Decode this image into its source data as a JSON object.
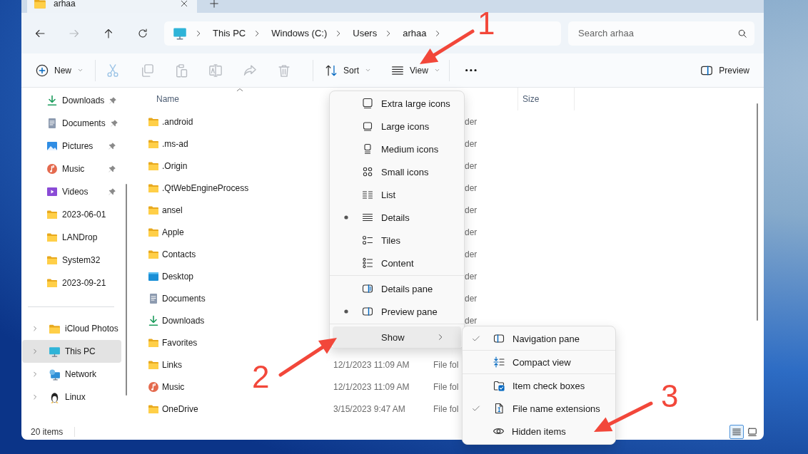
{
  "window": {
    "tab": {
      "title": "arhaa"
    }
  },
  "address_bar": {
    "nav": [
      {
        "kind": "back",
        "disabled": false
      },
      {
        "kind": "forward",
        "disabled": true
      },
      {
        "kind": "up",
        "disabled": false
      },
      {
        "kind": "refresh",
        "disabled": false
      }
    ],
    "breadcrumbs": [
      "This PC",
      "Windows (C:)",
      "Users",
      "arhaa"
    ],
    "search": {
      "placeholder": "Search arhaa"
    }
  },
  "toolbar": {
    "new": {
      "label": "New"
    },
    "actions": [
      {
        "kind": "cut",
        "disabled": true
      },
      {
        "kind": "copy",
        "disabled": true
      },
      {
        "kind": "paste",
        "disabled": true
      },
      {
        "kind": "rename",
        "disabled": true
      },
      {
        "kind": "share",
        "disabled": true
      },
      {
        "kind": "delete",
        "disabled": true
      }
    ],
    "sort": {
      "label": "Sort"
    },
    "view": {
      "label": "View"
    },
    "preview": {
      "label": "Preview"
    }
  },
  "sidebar": {
    "quick_access": [
      {
        "label": "Downloads",
        "kind": "downloads",
        "pinned": true
      },
      {
        "label": "Documents",
        "kind": "documents",
        "pinned": true
      },
      {
        "label": "Pictures",
        "kind": "pictures",
        "pinned": true
      },
      {
        "label": "Music",
        "kind": "music",
        "pinned": true
      },
      {
        "label": "Videos",
        "kind": "videos",
        "pinned": true
      },
      {
        "label": "2023-06-01",
        "kind": "folder",
        "pinned": false
      },
      {
        "label": "LANDrop",
        "kind": "folder",
        "pinned": false
      },
      {
        "label": "System32",
        "kind": "folder",
        "pinned": false
      },
      {
        "label": "2023-09-21",
        "kind": "folder",
        "pinned": false
      }
    ],
    "locations": [
      {
        "label": "iCloud Photos",
        "kind": "folder",
        "selected": false
      },
      {
        "label": "This PC",
        "kind": "pc",
        "selected": true
      },
      {
        "label": "Network",
        "kind": "network",
        "selected": false
      },
      {
        "label": "Linux",
        "kind": "linux",
        "selected": false
      }
    ]
  },
  "file_list": {
    "columns": [
      "Name",
      "Size"
    ],
    "rows": [
      {
        "name": ".android",
        "kind": "folder",
        "type": "der"
      },
      {
        "name": ".ms-ad",
        "kind": "folder",
        "type": "der"
      },
      {
        "name": ".Origin",
        "kind": "folder",
        "type": "der"
      },
      {
        "name": ".QtWebEngineProcess",
        "kind": "folder",
        "type": "der"
      },
      {
        "name": "ansel",
        "kind": "folder",
        "type": "der"
      },
      {
        "name": "Apple",
        "kind": "folder",
        "type": "der"
      },
      {
        "name": "Contacts",
        "kind": "folder",
        "type": "der"
      },
      {
        "name": "Desktop",
        "kind": "desktop",
        "type": "der"
      },
      {
        "name": "Documents",
        "kind": "documents",
        "type": "der"
      },
      {
        "name": "Downloads",
        "kind": "downloads",
        "type": "der"
      },
      {
        "name": "Favorites",
        "kind": "folder"
      },
      {
        "name": "Links",
        "kind": "folder",
        "date_modified": "12/1/2023 11:09 AM",
        "type": "File fol"
      },
      {
        "name": "Music",
        "kind": "music",
        "date_modified": "12/1/2023 11:09 AM",
        "type": "File fol"
      },
      {
        "name": "OneDrive",
        "kind": "folder",
        "date_modified": "3/15/2023 9:47 AM",
        "type": "File fol"
      }
    ]
  },
  "status_bar": {
    "item_count": "20 items",
    "view_toggle": [
      {
        "kind": "details",
        "selected": true
      },
      {
        "kind": "tiles",
        "selected": false
      }
    ]
  },
  "view_menu": {
    "groups": [
      [
        {
          "label": "Extra large icons",
          "kind": "extra-large-icons",
          "selected": false
        },
        {
          "label": "Large icons",
          "kind": "large-icons",
          "selected": false
        },
        {
          "label": "Medium icons",
          "kind": "medium-icons",
          "selected": false
        },
        {
          "label": "Small icons",
          "kind": "small-icons",
          "selected": false
        },
        {
          "label": "List",
          "kind": "list",
          "selected": false
        },
        {
          "label": "Details",
          "kind": "details",
          "selected": true
        },
        {
          "label": "Tiles",
          "kind": "tiles",
          "selected": false
        },
        {
          "label": "Content",
          "kind": "content",
          "selected": false
        }
      ],
      [
        {
          "label": "Details pane",
          "kind": "details-pane",
          "selected": false
        },
        {
          "label": "Preview pane",
          "kind": "preview-pane",
          "selected": true
        }
      ]
    ],
    "show": {
      "label": "Show",
      "highlighted": true
    }
  },
  "show_menu": {
    "groups": [
      [
        {
          "label": "Navigation pane",
          "kind": "navigation-pane",
          "checked": true
        }
      ],
      [
        {
          "label": "Compact view",
          "kind": "compact-view",
          "checked": false
        }
      ],
      [
        {
          "label": "Item check boxes",
          "kind": "item-check-boxes",
          "checked": false
        },
        {
          "label": "File name extensions",
          "kind": "file-name-extensions",
          "checked": true
        },
        {
          "label": "Hidden items",
          "kind": "hidden-items",
          "checked": false
        }
      ]
    ]
  },
  "annotations": [
    {
      "label": "1"
    },
    {
      "label": "2"
    },
    {
      "label": "3"
    }
  ]
}
